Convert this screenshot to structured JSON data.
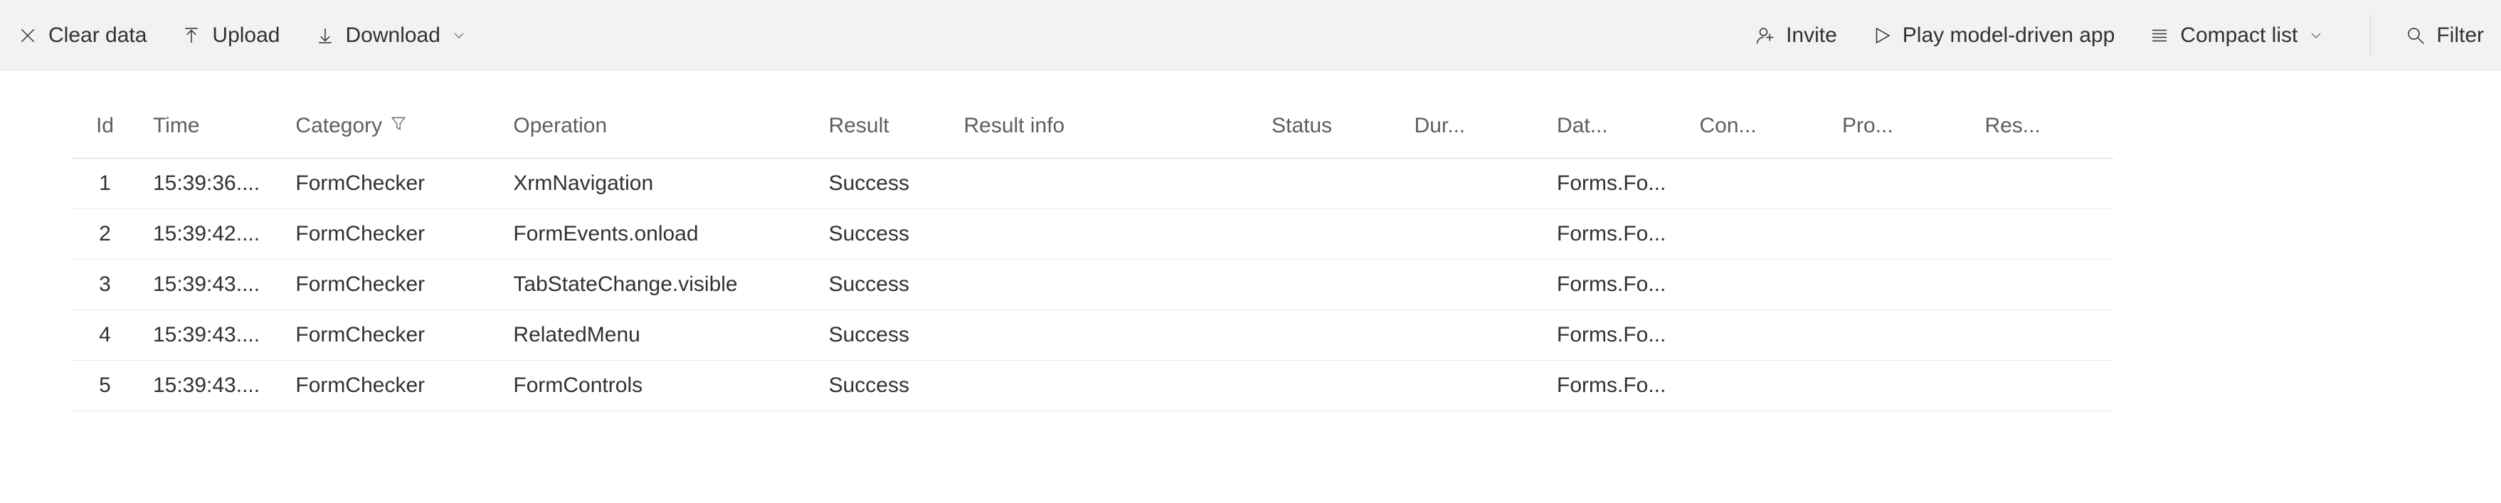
{
  "toolbar": {
    "clear_data": "Clear data",
    "upload": "Upload",
    "download": "Download",
    "invite": "Invite",
    "play": "Play model-driven app",
    "compact": "Compact list",
    "filter": "Filter"
  },
  "columns": {
    "id": "Id",
    "time": "Time",
    "category": "Category",
    "operation": "Operation",
    "result": "Result",
    "result_info": "Result info",
    "status": "Status",
    "duration": "Dur...",
    "data": "Dat...",
    "context": "Con...",
    "process": "Pro...",
    "resource": "Res..."
  },
  "rows": [
    {
      "id": "1",
      "time": "15:39:36....",
      "category": "FormChecker",
      "operation": "XrmNavigation",
      "result": "Success",
      "result_info": "",
      "status": "",
      "duration": "",
      "data": "Forms.Fo...",
      "context": "",
      "process": "",
      "resource": ""
    },
    {
      "id": "2",
      "time": "15:39:42....",
      "category": "FormChecker",
      "operation": "FormEvents.onload",
      "result": "Success",
      "result_info": "",
      "status": "",
      "duration": "",
      "data": "Forms.Fo...",
      "context": "",
      "process": "",
      "resource": ""
    },
    {
      "id": "3",
      "time": "15:39:43....",
      "category": "FormChecker",
      "operation": "TabStateChange.visible",
      "result": "Success",
      "result_info": "",
      "status": "",
      "duration": "",
      "data": "Forms.Fo...",
      "context": "",
      "process": "",
      "resource": ""
    },
    {
      "id": "4",
      "time": "15:39:43....",
      "category": "FormChecker",
      "operation": "RelatedMenu",
      "result": "Success",
      "result_info": "",
      "status": "",
      "duration": "",
      "data": "Forms.Fo...",
      "context": "",
      "process": "",
      "resource": ""
    },
    {
      "id": "5",
      "time": "15:39:43....",
      "category": "FormChecker",
      "operation": "FormControls",
      "result": "Success",
      "result_info": "",
      "status": "",
      "duration": "",
      "data": "Forms.Fo...",
      "context": "",
      "process": "",
      "resource": ""
    }
  ]
}
